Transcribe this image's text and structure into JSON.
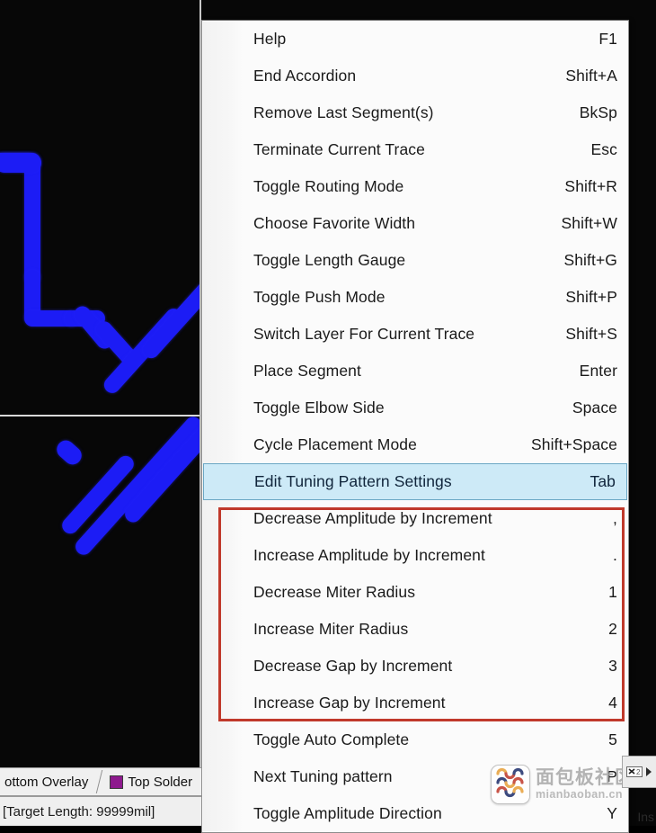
{
  "app": {
    "accent_highlight": "#cdeaf7",
    "accent_highlight_border": "#6ba7c4",
    "annotation_box_color": "#c0392b",
    "trace_color": "#1c1cf5",
    "canvas_background": "#070707"
  },
  "menu": {
    "name": "interactive-routing-shortcut-menu",
    "items": [
      {
        "label": "Help",
        "shortcut": "F1",
        "state": "normal"
      },
      {
        "label": "End Accordion",
        "shortcut": "Shift+A",
        "state": "normal"
      },
      {
        "label": "Remove Last Segment(s)",
        "shortcut": "BkSp",
        "state": "normal"
      },
      {
        "label": "Terminate Current Trace",
        "shortcut": "Esc",
        "state": "normal"
      },
      {
        "label": "Toggle Routing Mode",
        "shortcut": "Shift+R",
        "state": "normal"
      },
      {
        "label": "Choose Favorite Width",
        "shortcut": "Shift+W",
        "state": "normal"
      },
      {
        "label": "Toggle Length Gauge",
        "shortcut": "Shift+G",
        "state": "normal"
      },
      {
        "label": "Toggle Push Mode",
        "shortcut": "Shift+P",
        "state": "normal"
      },
      {
        "label": "Switch Layer For Current Trace",
        "shortcut": "Shift+S",
        "state": "normal"
      },
      {
        "label": "Place Segment",
        "shortcut": "Enter",
        "state": "normal"
      },
      {
        "label": "Toggle Elbow Side",
        "shortcut": "Space",
        "state": "normal"
      },
      {
        "label": "Cycle Placement Mode",
        "shortcut": "Shift+Space",
        "state": "normal"
      },
      {
        "label": "Edit Tuning Pattern Settings",
        "shortcut": "Tab",
        "state": "highlighted"
      },
      {
        "label": "Decrease Amplitude by Increment",
        "shortcut": ",",
        "state": "boxed"
      },
      {
        "label": "Increase Amplitude by Increment",
        "shortcut": ".",
        "state": "boxed"
      },
      {
        "label": "Decrease Miter Radius",
        "shortcut": "1",
        "state": "boxed"
      },
      {
        "label": "Increase Miter Radius",
        "shortcut": "2",
        "state": "boxed"
      },
      {
        "label": "Decrease Gap by Increment",
        "shortcut": "3",
        "state": "boxed"
      },
      {
        "label": "Increase Gap by Increment",
        "shortcut": "4",
        "state": "boxed"
      },
      {
        "label": "Toggle Auto Complete",
        "shortcut": "5",
        "state": "normal"
      },
      {
        "label": "Next Tuning pattern",
        "shortcut": "P",
        "state": "normal"
      },
      {
        "label": "Toggle Amplitude Direction",
        "shortcut": "Y",
        "state": "normal"
      }
    ]
  },
  "status_bar": {
    "layer_left": "ottom Overlay",
    "layer_right": "Top Solder",
    "layer_right_color": "#8e1a8e",
    "target_length": "[Target Length:  99999mil]"
  },
  "edge": {
    "insert_label": "Ins"
  },
  "watermark": {
    "title_cn": "面包板社区",
    "url": "mianbaoban.cn"
  }
}
